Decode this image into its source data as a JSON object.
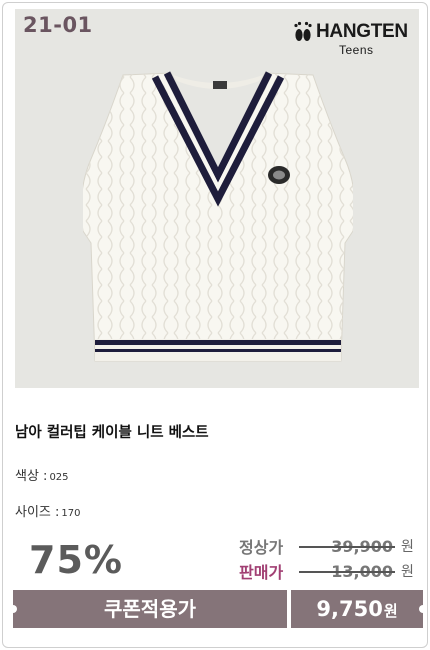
{
  "product": {
    "code": "21-01",
    "brand": {
      "name": "HANGTEN",
      "sub": "Teens"
    },
    "title": "남아 컬러팁 케이블 니트 베스트",
    "options": {
      "color_label": "색상 :",
      "color_value": "025",
      "size_label": "사이즈 :",
      "size_value": "170"
    }
  },
  "pricing": {
    "discount": "75%",
    "regular_label": "정상가",
    "regular_price": "39,900",
    "sale_label": "판매가",
    "sale_price": "13,000",
    "unit": "원",
    "coupon_label": "쿠폰적용가",
    "final_price": "9,750",
    "final_unit": "원"
  },
  "colors": {
    "accent": "#857479",
    "sale_label": "#a13f73",
    "trim_navy": "#1e1d3b"
  },
  "icons": [
    "footprint-logo-icon"
  ]
}
